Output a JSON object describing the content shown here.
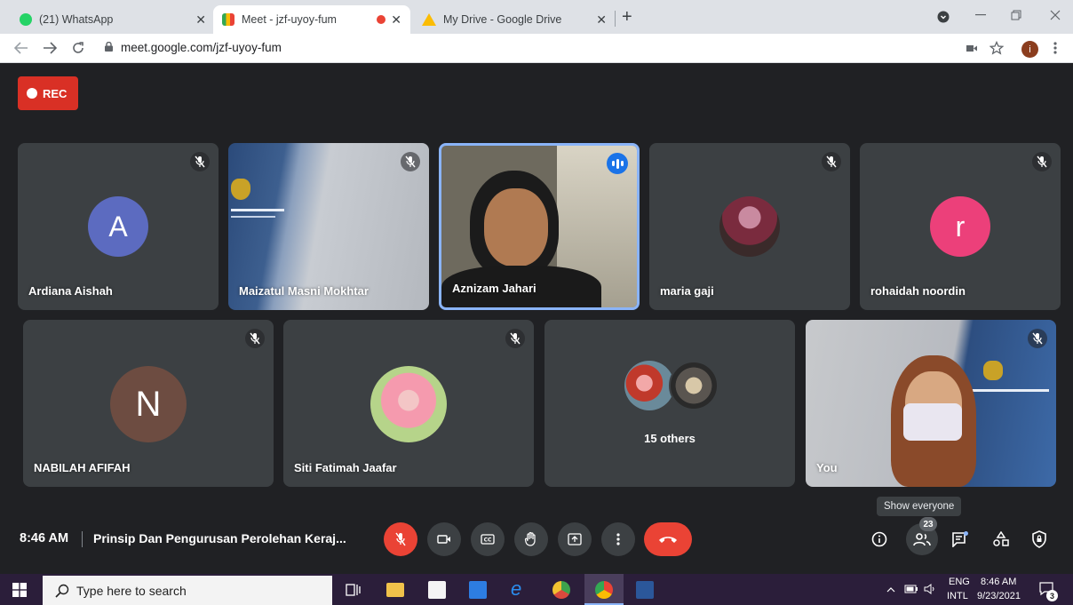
{
  "browser": {
    "tabs": [
      {
        "title": "(21) WhatsApp",
        "close": "✕"
      },
      {
        "title": "Meet - jzf-uyoy-fum",
        "close": "✕"
      },
      {
        "title": "My Drive - Google Drive",
        "close": "✕"
      }
    ],
    "new_tab": "+",
    "url": "meet.google.com/jzf-uyoy-fum",
    "profile_initial": "i"
  },
  "meet": {
    "rec_label": "REC",
    "participants": [
      {
        "name": "Ardiana Aishah",
        "initial": "A",
        "avatar_color": "#5c6bc0"
      },
      {
        "name": "Maizatul Masni Mokhtar"
      },
      {
        "name": "Aznizam Jahari",
        "speaking": true
      },
      {
        "name": "maria gaji"
      },
      {
        "name": "rohaidah noordin",
        "initial": "r",
        "avatar_color": "#ec407a"
      },
      {
        "name": "NABILAH AFIFAH",
        "initial": "N",
        "avatar_color": "#6d4c41"
      },
      {
        "name": "Siti Fatimah Jaafar"
      },
      {
        "name": "15 others"
      },
      {
        "name": "You"
      }
    ],
    "bottom": {
      "time": "8:46 AM",
      "title": "Prinsip Dan Pengurusan Perolehan Keraj...",
      "tooltip": "Show everyone",
      "participant_count": "23"
    }
  },
  "taskbar": {
    "search_placeholder": "Type here to search",
    "lang_top": "ENG",
    "lang_bottom": "INTL",
    "clock_time": "8:46 AM",
    "clock_date": "9/23/2021",
    "notification_count": "3"
  }
}
